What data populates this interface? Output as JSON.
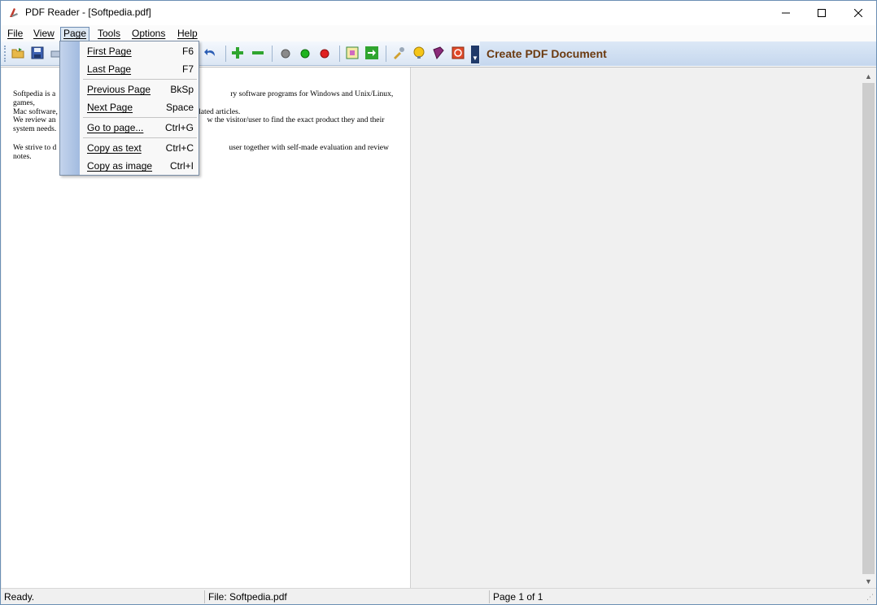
{
  "window": {
    "title": "PDF Reader - [Softpedia.pdf]",
    "controls": {
      "minimize": "—",
      "maximize": "☐",
      "close": "✕"
    }
  },
  "menubar": {
    "items": [
      "File",
      "View",
      "Page",
      "Tools",
      "Options",
      "Help"
    ],
    "active": "Page"
  },
  "toolbar": {
    "icons": [
      "open-folder-icon",
      "save-disk-icon",
      "print-icon",
      "back-arrow-icon",
      "zoom-in-icon",
      "zoom-out-icon",
      "gray-circle-icon",
      "green-circle-icon",
      "red-circle-icon",
      "fit-page-icon",
      "go-arrow-icon",
      "wrench-icon",
      "bulb-icon",
      "book-icon",
      "power-icon"
    ],
    "create_pdf": "Create PDF Document",
    "accent": "#6b3a10"
  },
  "page_menu": {
    "items": [
      {
        "label": "First Page",
        "shortcut": "F6"
      },
      {
        "label": "Last Page",
        "shortcut": "F7"
      },
      {
        "label": "Previous Page",
        "shortcut": "BkSp"
      },
      {
        "label": "Next Page",
        "shortcut": "Space"
      },
      {
        "label": "Go to page...",
        "shortcut": "Ctrl+G"
      },
      {
        "label": "Copy as text",
        "shortcut": "Ctrl+C"
      },
      {
        "label": "Copy as image",
        "shortcut": "Ctrl+I"
      }
    ]
  },
  "document": {
    "para1_left": "Softpedia is a",
    "para1_right": "ry software programs for Windows and Unix/Linux, games,",
    "para1b_left": "Mac software,",
    "para1b_right": "elated articles.",
    "para2_left": "We review an",
    "para2_right": "w the visitor/user to find the exact product they and their",
    "para2b": "system needs.",
    "para3_left": "We strive to d",
    "para3_right": "user together with self-made evaluation and review notes."
  },
  "statusbar": {
    "status": "Ready.",
    "file": "File: Softpedia.pdf",
    "page": "Page 1 of 1"
  }
}
